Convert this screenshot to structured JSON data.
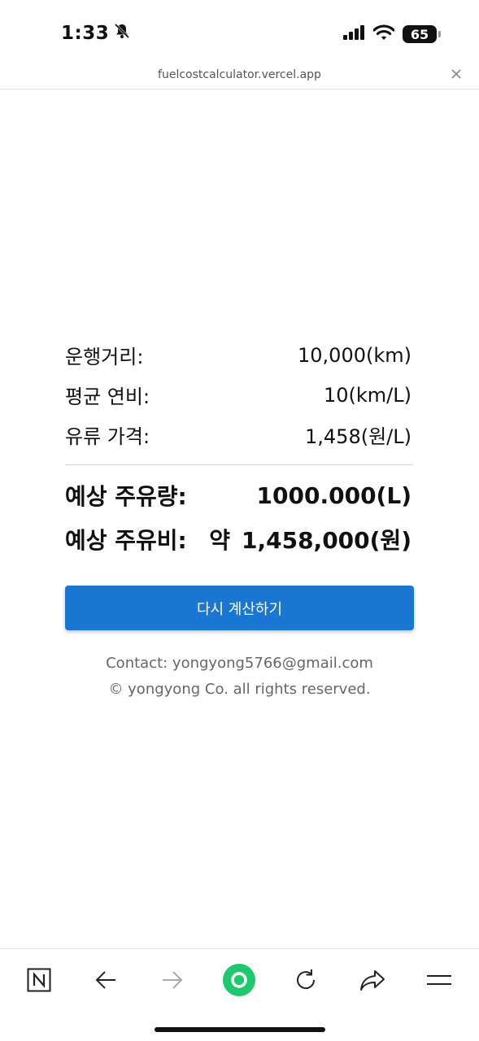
{
  "status_bar": {
    "time": "1:33",
    "battery": "65",
    "icons": [
      "bell-slash-icon",
      "signal-icon",
      "wifi-icon",
      "battery-icon"
    ]
  },
  "browser": {
    "url": "fuelcostcalculator.vercel.app",
    "close_icon": "close-icon"
  },
  "results": {
    "inputs": [
      {
        "label": "운행거리:",
        "value": "10,000(km)"
      },
      {
        "label": "평균 연비:",
        "value": "10(km/L)"
      },
      {
        "label": "유류 가격:",
        "value": "1,458(원/L)"
      }
    ],
    "outputs": [
      {
        "label": "예상 주유량:",
        "prefix": "",
        "value": "1000.000(L)"
      },
      {
        "label": "예상 주유비:",
        "prefix": "약",
        "value": "1,458,000(원)"
      }
    ]
  },
  "recalc_button": {
    "label": "다시 계산하기",
    "color": "#1976d2"
  },
  "footer": {
    "contact": "Contact: yongyong5766@gmail.com",
    "copyright": "© yongyong Co. all rights reserved."
  },
  "toolbar": {
    "items": [
      "naver-n-icon",
      "back-arrow-icon",
      "forward-arrow-icon",
      "green-dot-icon",
      "reload-icon",
      "share-icon",
      "menu-icon"
    ],
    "accent": "#1ec96e"
  }
}
